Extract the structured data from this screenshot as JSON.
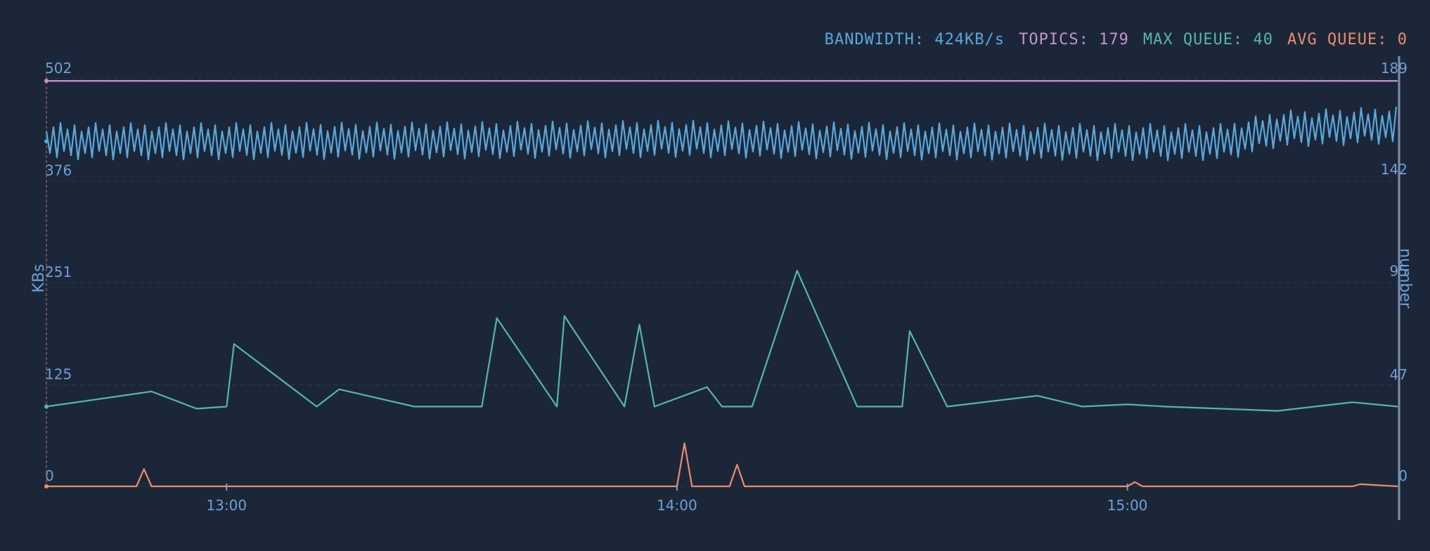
{
  "colors": {
    "background": "#1b2738",
    "bandwidth": "#5aa7dc",
    "topics": "#c592cf",
    "max_queue": "#56b7a2",
    "avg_queue": "#ee8b6d",
    "axis": "#6f9fd8",
    "grid": "#2a3a50"
  },
  "stats": {
    "bandwidth_label": "BANDWIDTH:",
    "bandwidth_value": "424KB/s",
    "topics_label": "TOPICS:",
    "topics_value": "179",
    "max_queue_label": "MAX QUEUE:",
    "max_queue_value": "40",
    "avg_queue_label": "AVG QUEUE:",
    "avg_queue_value": "0"
  },
  "chart_data": {
    "type": "line",
    "x_range": [
      "12:36",
      "15:36"
    ],
    "x_ticks": [
      "13:00",
      "14:00",
      "15:00"
    ],
    "y_left": {
      "label": "KBs",
      "range": [
        0,
        502
      ],
      "ticks": [
        0,
        125,
        251,
        376,
        502
      ]
    },
    "y_right": {
      "label": "number",
      "range": [
        0,
        189
      ],
      "ticks": [
        0,
        47,
        95,
        142,
        189
      ]
    },
    "grid": true,
    "legend": "none",
    "series": [
      {
        "key": "bandwidth",
        "axis": "left",
        "x": [
          "12:36",
          "13:00",
          "13:30",
          "14:00",
          "14:30",
          "15:00",
          "15:13",
          "15:20",
          "15:36"
        ],
        "y": [
          425,
          425,
          426,
          428,
          425,
          424,
          424,
          440,
          445
        ]
      },
      {
        "key": "topics",
        "axis": "right",
        "x": [
          "12:36",
          "15:36"
        ],
        "y": [
          188,
          188
        ]
      },
      {
        "key": "max_queue",
        "axis": "right",
        "x": [
          "12:36",
          "12:50",
          "12:56",
          "13:00",
          "13:01",
          "13:12",
          "13:15",
          "13:25",
          "13:34",
          "13:36",
          "13:44",
          "13:45",
          "13:53",
          "13:55",
          "13:57",
          "14:04",
          "14:06",
          "14:10",
          "14:16",
          "14:24",
          "14:30",
          "14:31",
          "14:36",
          "14:48",
          "14:54",
          "15:00",
          "15:05",
          "15:20",
          "15:30",
          "15:36"
        ],
        "y": [
          37,
          44,
          36,
          37,
          66,
          37,
          45,
          37,
          37,
          78,
          37,
          79,
          37,
          75,
          37,
          46,
          37,
          37,
          100,
          37,
          37,
          72,
          37,
          42,
          37,
          38,
          37,
          35,
          39,
          37
        ]
      },
      {
        "key": "avg_queue",
        "axis": "right",
        "x": [
          "12:36",
          "12:48",
          "12:49",
          "12:50",
          "14:00",
          "14:01",
          "14:02",
          "14:07",
          "14:08",
          "14:09",
          "15:00",
          "15:01",
          "15:02",
          "15:30",
          "15:31",
          "15:36"
        ],
        "y": [
          0,
          0,
          8,
          0,
          0,
          20,
          0,
          0,
          10,
          0,
          0,
          2,
          0,
          0,
          1,
          0
        ]
      }
    ]
  }
}
